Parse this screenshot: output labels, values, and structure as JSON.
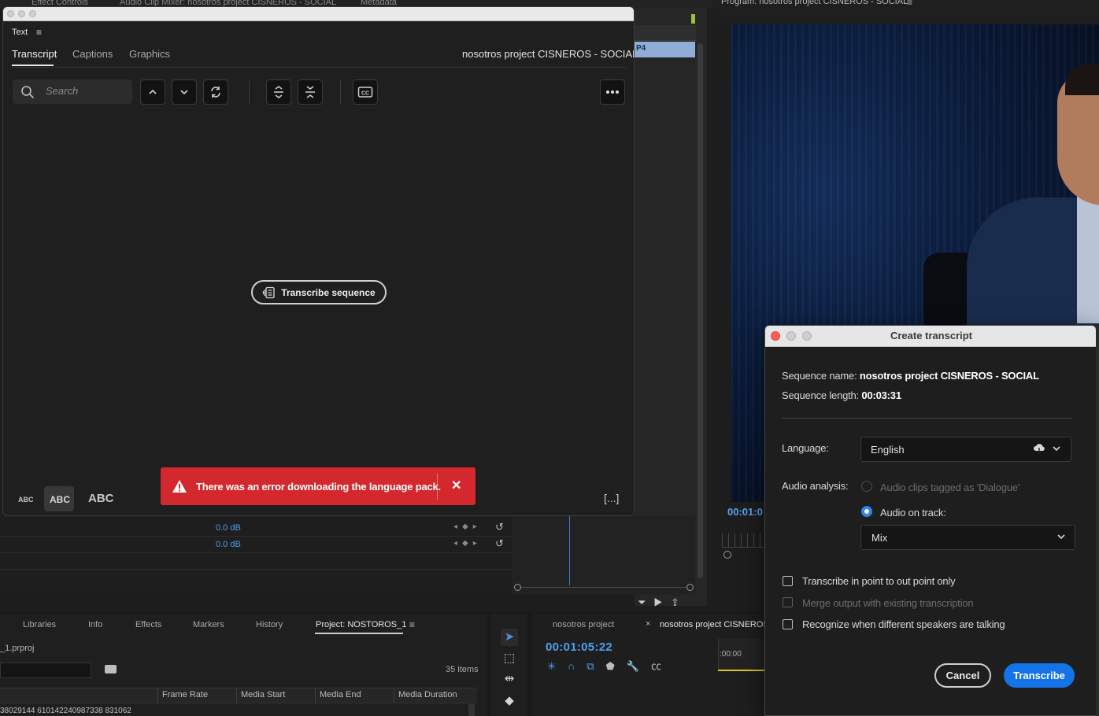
{
  "top_tabs": {
    "effect_controls": "Effect Controls",
    "audio_clip_mixer": "Audio Clip Mixer: nosotros project CISNEROS - SOCIAL",
    "metadata": "Metadata"
  },
  "timeline_clip_label": "P4",
  "program": {
    "title": "Program: nosotros project CISNEROS - SOCIAL",
    "timecode": "00:01:0"
  },
  "text_panel": {
    "tab_label": "Text",
    "subtabs": [
      "Transcript",
      "Captions",
      "Graphics"
    ],
    "sequence_title": "nosotros project CISNEROS - SOCIAL",
    "search_placeholder": "Search",
    "transcribe_button": "Transcribe sequence",
    "text_sizes": [
      "ABC",
      "ABC",
      "ABC"
    ],
    "bracket_label": "[...]"
  },
  "error_toast": {
    "message": "There was an error downloading the language pack.",
    "color": "#d3282d"
  },
  "effect_controls": {
    "rows": [
      {
        "value": "0.0 dB"
      },
      {
        "value": "0.0 dB"
      }
    ]
  },
  "project_panel": {
    "tabs": [
      "Libraries",
      "Info",
      "Effects",
      "Markers",
      "History",
      "Project: NOSTOROS_1"
    ],
    "file_name": "_1.prproj",
    "item_count": "35 items",
    "columns": [
      "Frame Rate",
      "Media Start",
      "Media End",
      "Media Duration"
    ],
    "row_text": "38029144  610142240987338  831062"
  },
  "timeline_panel": {
    "tabs": [
      "nosotros project",
      "nosotros project CISNEROS"
    ],
    "timecode": "00:01:05:22",
    "ruler_timecode": ":00:00"
  },
  "dialog": {
    "title": "Create transcript",
    "sequence_name_label": "Sequence name:",
    "sequence_name_value": "nosotros project CISNEROS - SOCIAL",
    "sequence_length_label": "Sequence length:",
    "sequence_length_value": "00:03:31",
    "language_label": "Language:",
    "language_value": "English",
    "audio_analysis_label": "Audio analysis:",
    "radio_dialogue": "Audio clips tagged as 'Dialogue'",
    "radio_track": "Audio on track:",
    "track_value": "Mix",
    "check_in_out": "Transcribe in point to out point only",
    "check_merge": "Merge output with existing transcription",
    "check_speakers": "Recognize when different speakers are talking",
    "cancel_label": "Cancel",
    "transcribe_label": "Transcribe",
    "accent": "#1473e6"
  }
}
